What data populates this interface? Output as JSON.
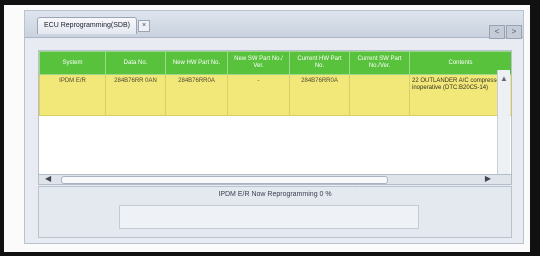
{
  "window": {
    "tab_label": "ECU Reprogramming(SDB)",
    "tab_close": "×",
    "nav_prev": "<",
    "nav_next": ">"
  },
  "table": {
    "columns": [
      "System",
      "Data No.",
      "New HW Part No.",
      "New SW Part No./ Ver.",
      "Current HW Part No.",
      "Current SW Part No./Ver.",
      "Contents"
    ],
    "rows": [
      {
        "system": "IPDM E/R",
        "data_no": "284B76RR 0AN",
        "new_hw": "284B76RR0A",
        "new_sw": "-",
        "current_hw": "284B76RR0A",
        "current_sw": "",
        "contents": "22 OUTLANDER A/C compressor inoperative (DTC:B20C5-14)"
      }
    ]
  },
  "status": {
    "message": "IPDM E/R Now Reprogramming 0 %",
    "progress_percent": 0
  },
  "colors": {
    "header_green": "#58c23c",
    "row_yellow": "#f2e779"
  }
}
